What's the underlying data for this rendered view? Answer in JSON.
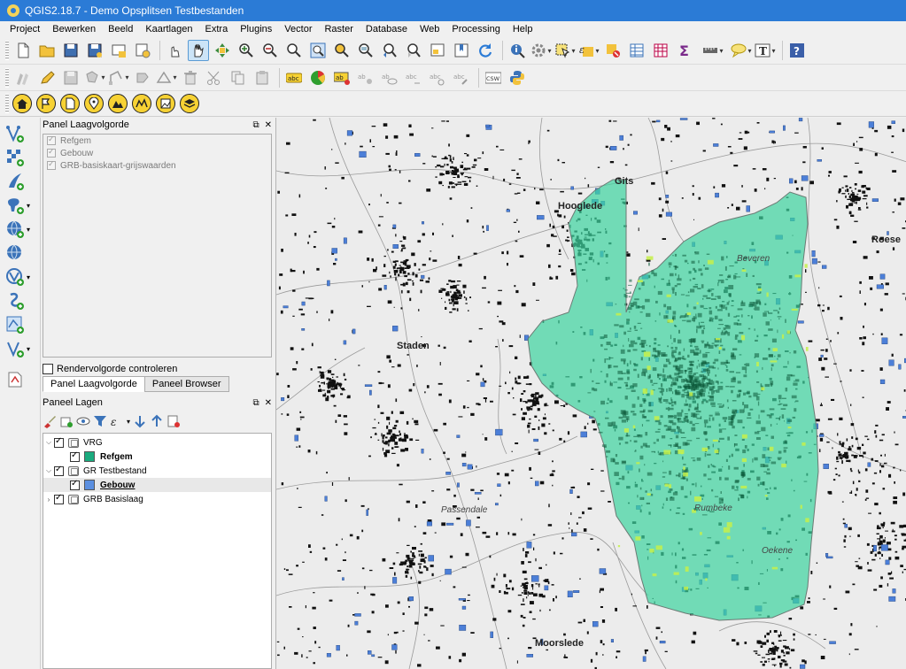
{
  "window": {
    "title": "QGIS2.18.7 - Demo Opsplitsen Testbestanden"
  },
  "menu": [
    "Project",
    "Bewerken",
    "Beeld",
    "Kaartlagen",
    "Extra",
    "Plugins",
    "Vector",
    "Raster",
    "Database",
    "Web",
    "Processing",
    "Help"
  ],
  "toolbar2": {
    "csw_label": "CSW",
    "abc_label": "abc"
  },
  "order_panel": {
    "title": "Panel Laagvolgorde",
    "items": [
      "Refgem",
      "Gebouw",
      "GRB-basiskaart-grijswaarden"
    ],
    "render_control_label": "Rendervolgorde controleren",
    "tabs": [
      "Panel Laagvolgorde",
      "Paneel Browser"
    ]
  },
  "layers_panel": {
    "title": "Paneel Lagen",
    "layers": [
      {
        "name": "VRG",
        "type": "group",
        "expanded": true
      },
      {
        "name": "Refgem",
        "type": "layer",
        "color": "#1aab7e",
        "bold": true
      },
      {
        "name": "GR Testbestand",
        "type": "group",
        "expanded": true
      },
      {
        "name": "Gebouw",
        "type": "layer",
        "color": "#5b8fe0",
        "bold": true,
        "underline": true
      },
      {
        "name": "GRB Basislaag",
        "type": "group",
        "expanded": false
      }
    ]
  },
  "map": {
    "labels": [
      "Hooglede",
      "Staden",
      "Beveren",
      "Passendale",
      "Rumbeke",
      "Oekene",
      "Moorslede",
      "Gits",
      "Roese"
    ],
    "polygon_color": "#3dd4a0",
    "building_color": "#111111",
    "blue_building_color": "#4c7fd8"
  },
  "colors": {
    "titlebar": "#2b7bd6",
    "accent_yellow": "#f7d234"
  }
}
